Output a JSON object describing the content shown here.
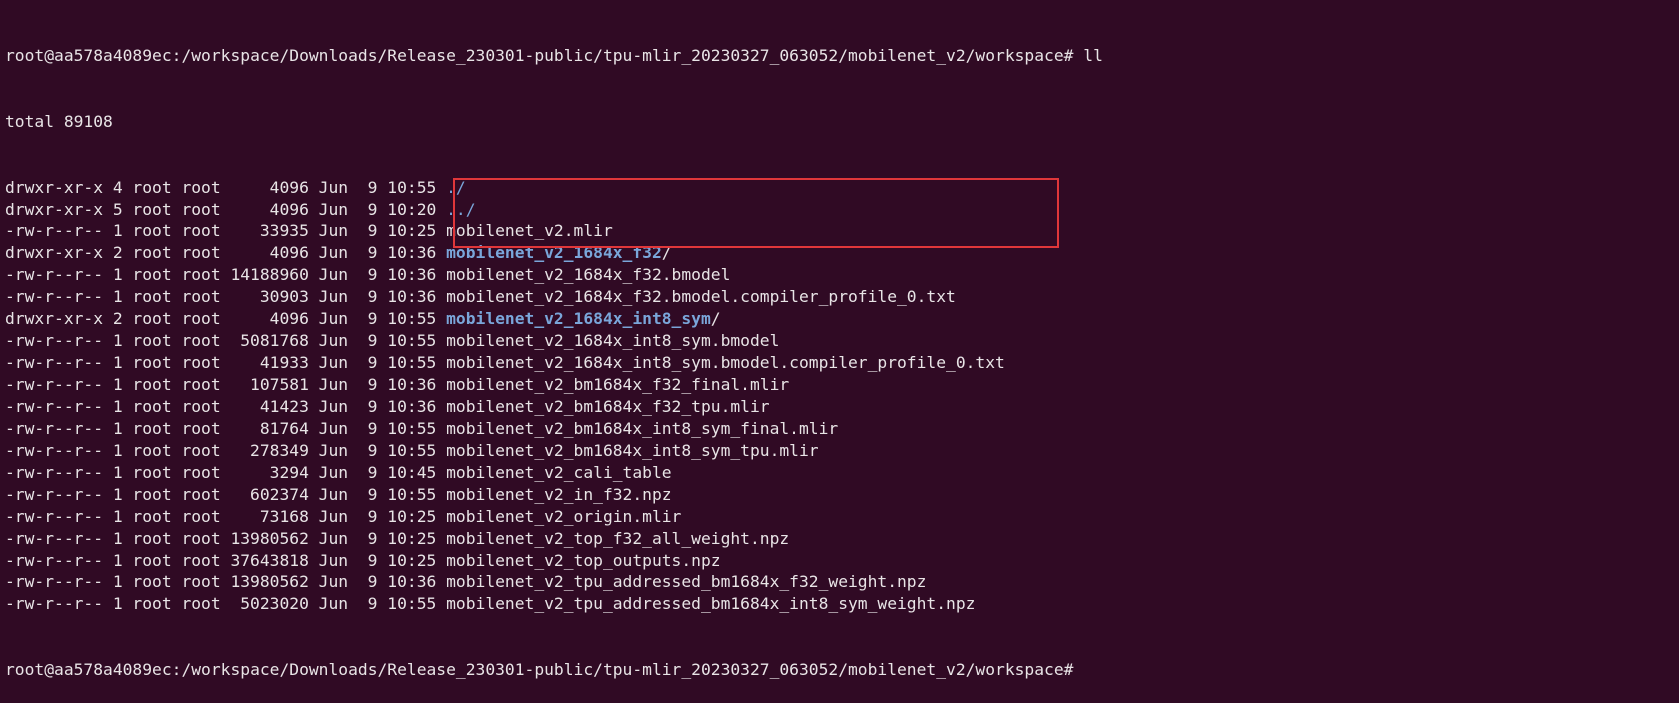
{
  "prompt": {
    "user_host": "root@aa578a4089ec",
    "path": "/workspace/Downloads/Release_230301-public/tpu-mlir_20230327_063052/mobilenet_v2/workspace",
    "symbol": "#",
    "command": "ll"
  },
  "total_line": "total 89108",
  "entries": [
    {
      "perms": "drwxr-xr-x",
      "links": "4",
      "owner": "root",
      "group": "root",
      "size": "4096",
      "month": "Jun",
      "day": "9",
      "time": "10:55",
      "name": "./",
      "suffix": "",
      "type": "dir-plain"
    },
    {
      "perms": "drwxr-xr-x",
      "links": "5",
      "owner": "root",
      "group": "root",
      "size": "4096",
      "month": "Jun",
      "day": "9",
      "time": "10:20",
      "name": "../",
      "suffix": "",
      "type": "dir-plain"
    },
    {
      "perms": "-rw-r--r--",
      "links": "1",
      "owner": "root",
      "group": "root",
      "size": "33935",
      "month": "Jun",
      "day": "9",
      "time": "10:25",
      "name": "mobilenet_v2.mlir",
      "suffix": "",
      "type": "file"
    },
    {
      "perms": "drwxr-xr-x",
      "links": "2",
      "owner": "root",
      "group": "root",
      "size": "4096",
      "month": "Jun",
      "day": "9",
      "time": "10:36",
      "name": "mobilenet_v2_1684x_f32",
      "suffix": "/",
      "type": "dir"
    },
    {
      "perms": "-rw-r--r--",
      "links": "1",
      "owner": "root",
      "group": "root",
      "size": "14188960",
      "month": "Jun",
      "day": "9",
      "time": "10:36",
      "name": "mobilenet_v2_1684x_f32.bmodel",
      "suffix": "",
      "type": "file"
    },
    {
      "perms": "-rw-r--r--",
      "links": "1",
      "owner": "root",
      "group": "root",
      "size": "30903",
      "month": "Jun",
      "day": "9",
      "time": "10:36",
      "name": "mobilenet_v2_1684x_f32.bmodel.compiler_profile_0.txt",
      "suffix": "",
      "type": "file"
    },
    {
      "perms": "drwxr-xr-x",
      "links": "2",
      "owner": "root",
      "group": "root",
      "size": "4096",
      "month": "Jun",
      "day": "9",
      "time": "10:55",
      "name": "mobilenet_v2_1684x_int8_sym",
      "suffix": "/",
      "type": "dir"
    },
    {
      "perms": "-rw-r--r--",
      "links": "1",
      "owner": "root",
      "group": "root",
      "size": "5081768",
      "month": "Jun",
      "day": "9",
      "time": "10:55",
      "name": "mobilenet_v2_1684x_int8_sym.bmodel",
      "suffix": "",
      "type": "file"
    },
    {
      "perms": "-rw-r--r--",
      "links": "1",
      "owner": "root",
      "group": "root",
      "size": "41933",
      "month": "Jun",
      "day": "9",
      "time": "10:55",
      "name": "mobilenet_v2_1684x_int8_sym.bmodel.compiler_profile_0.txt",
      "suffix": "",
      "type": "file"
    },
    {
      "perms": "-rw-r--r--",
      "links": "1",
      "owner": "root",
      "group": "root",
      "size": "107581",
      "month": "Jun",
      "day": "9",
      "time": "10:36",
      "name": "mobilenet_v2_bm1684x_f32_final.mlir",
      "suffix": "",
      "type": "file"
    },
    {
      "perms": "-rw-r--r--",
      "links": "1",
      "owner": "root",
      "group": "root",
      "size": "41423",
      "month": "Jun",
      "day": "9",
      "time": "10:36",
      "name": "mobilenet_v2_bm1684x_f32_tpu.mlir",
      "suffix": "",
      "type": "file"
    },
    {
      "perms": "-rw-r--r--",
      "links": "1",
      "owner": "root",
      "group": "root",
      "size": "81764",
      "month": "Jun",
      "day": "9",
      "time": "10:55",
      "name": "mobilenet_v2_bm1684x_int8_sym_final.mlir",
      "suffix": "",
      "type": "file"
    },
    {
      "perms": "-rw-r--r--",
      "links": "1",
      "owner": "root",
      "group": "root",
      "size": "278349",
      "month": "Jun",
      "day": "9",
      "time": "10:55",
      "name": "mobilenet_v2_bm1684x_int8_sym_tpu.mlir",
      "suffix": "",
      "type": "file"
    },
    {
      "perms": "-rw-r--r--",
      "links": "1",
      "owner": "root",
      "group": "root",
      "size": "3294",
      "month": "Jun",
      "day": "9",
      "time": "10:45",
      "name": "mobilenet_v2_cali_table",
      "suffix": "",
      "type": "file"
    },
    {
      "perms": "-rw-r--r--",
      "links": "1",
      "owner": "root",
      "group": "root",
      "size": "602374",
      "month": "Jun",
      "day": "9",
      "time": "10:55",
      "name": "mobilenet_v2_in_f32.npz",
      "suffix": "",
      "type": "file"
    },
    {
      "perms": "-rw-r--r--",
      "links": "1",
      "owner": "root",
      "group": "root",
      "size": "73168",
      "month": "Jun",
      "day": "9",
      "time": "10:25",
      "name": "mobilenet_v2_origin.mlir",
      "suffix": "",
      "type": "file"
    },
    {
      "perms": "-rw-r--r--",
      "links": "1",
      "owner": "root",
      "group": "root",
      "size": "13980562",
      "month": "Jun",
      "day": "9",
      "time": "10:25",
      "name": "mobilenet_v2_top_f32_all_weight.npz",
      "suffix": "",
      "type": "file"
    },
    {
      "perms": "-rw-r--r--",
      "links": "1",
      "owner": "root",
      "group": "root",
      "size": "37643818",
      "month": "Jun",
      "day": "9",
      "time": "10:25",
      "name": "mobilenet_v2_top_outputs.npz",
      "suffix": "",
      "type": "file"
    },
    {
      "perms": "-rw-r--r--",
      "links": "1",
      "owner": "root",
      "group": "root",
      "size": "13980562",
      "month": "Jun",
      "day": "9",
      "time": "10:36",
      "name": "mobilenet_v2_tpu_addressed_bm1684x_f32_weight.npz",
      "suffix": "",
      "type": "file"
    },
    {
      "perms": "-rw-r--r--",
      "links": "1",
      "owner": "root",
      "group": "root",
      "size": "5023020",
      "month": "Jun",
      "day": "9",
      "time": "10:55",
      "name": "mobilenet_v2_tpu_addressed_bm1684x_int8_sym_weight.npz",
      "suffix": "",
      "type": "file"
    }
  ],
  "final_prompt": {
    "user_host": "root@aa578a4089ec",
    "path": "/workspace/Downloads/Release_230301-public/tpu-mlir_20230327_063052/mobilenet_v2/workspace",
    "symbol": "#"
  },
  "colors": {
    "background": "#300a24",
    "text": "#e8e4e6",
    "directory": "#7aa6da",
    "highlight_border": "#e0373a"
  }
}
